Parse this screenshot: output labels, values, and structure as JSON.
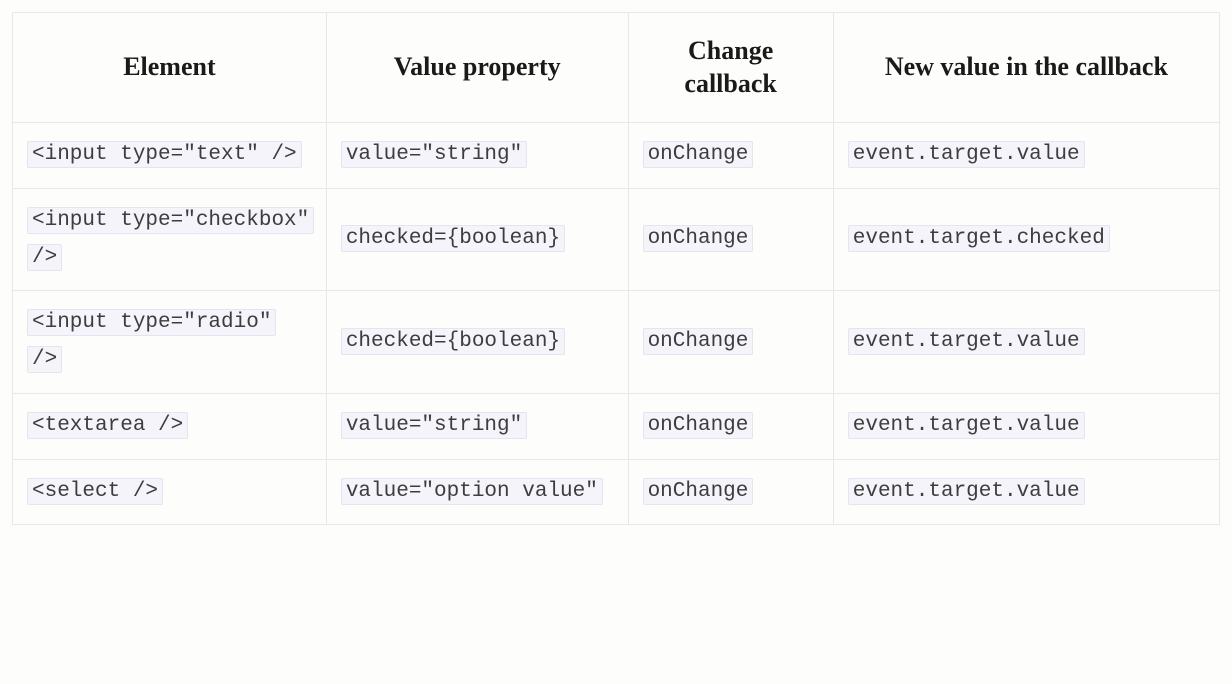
{
  "table": {
    "headers": {
      "element": "Element",
      "value_property": "Value property",
      "change_callback": "Change callback",
      "new_value": "New value in the callback"
    },
    "rows": [
      {
        "element": "<input type=\"text\" />",
        "value_property": "value=\"string\"",
        "change_callback": "onChange",
        "new_value": "event.target.value"
      },
      {
        "element": "<input type=\"checkbox\" />",
        "value_property": "checked={boolean}",
        "change_callback": "onChange",
        "new_value": "event.target.checked"
      },
      {
        "element": "<input type=\"radio\" />",
        "value_property": "checked={boolean}",
        "change_callback": "onChange",
        "new_value": "event.target.value"
      },
      {
        "element": "<textarea />",
        "value_property": "value=\"string\"",
        "change_callback": "onChange",
        "new_value": "event.target.value"
      },
      {
        "element": "<select />",
        "value_property": "value=\"option value\"",
        "change_callback": "onChange",
        "new_value": "event.target.value"
      }
    ]
  }
}
